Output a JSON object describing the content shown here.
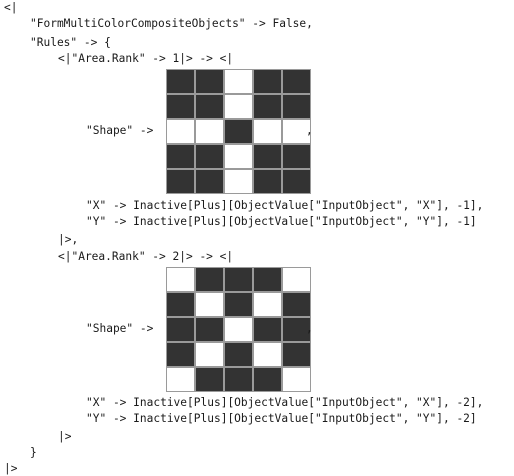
{
  "code": {
    "open_assoc": "<|",
    "form_line": "\"FormMultiColorCompositeObjects\" -> False,",
    "rules_line": "\"Rules\" -> {",
    "rules": [
      {
        "header": "<|\"Area.Rank\" -> 1|> -> <|",
        "shape_label": "\"Shape\" ->",
        "shape_comma": ",",
        "shape_grid": [
          [
            1,
            1,
            0,
            1,
            1
          ],
          [
            1,
            1,
            0,
            1,
            1
          ],
          [
            0,
            0,
            1,
            0,
            0
          ],
          [
            1,
            1,
            0,
            1,
            1
          ],
          [
            1,
            1,
            0,
            1,
            1
          ]
        ],
        "x_line": "\"X\" -> Inactive[Plus][ObjectValue[\"InputObject\", \"X\"], -1],",
        "y_line": "\"Y\" -> Inactive[Plus][ObjectValue[\"InputObject\", \"Y\"], -1]",
        "close": "|>,"
      },
      {
        "header": "<|\"Area.Rank\" -> 2|> -> <|",
        "shape_label": "\"Shape\" ->",
        "shape_comma": ",",
        "shape_grid": [
          [
            0,
            1,
            1,
            1,
            0
          ],
          [
            1,
            0,
            1,
            0,
            1
          ],
          [
            1,
            1,
            0,
            1,
            1
          ],
          [
            1,
            0,
            1,
            0,
            1
          ],
          [
            0,
            1,
            1,
            1,
            0
          ]
        ],
        "x_line": "\"X\" -> Inactive[Plus][ObjectValue[\"InputObject\", \"X\"], -2],",
        "y_line": "\"Y\" -> Inactive[Plus][ObjectValue[\"InputObject\", \"Y\"], -2]",
        "close": "|>"
      }
    ],
    "close_rules": "}",
    "close_assoc": "|>"
  }
}
